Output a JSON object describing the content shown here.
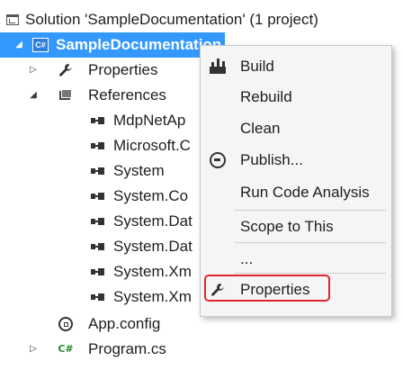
{
  "solution": {
    "label": "Solution 'SampleDocumentation' (1 project)",
    "icon": "solution-icon"
  },
  "project": {
    "label": "SampleDocumentation",
    "icon": "csharp-project-icon",
    "expanded": true,
    "selected": true
  },
  "tree_items": [
    {
      "label": "Properties",
      "icon": "wrench-icon",
      "arrow": "▷"
    },
    {
      "label": "References",
      "icon": "references-icon",
      "arrow": "◢"
    },
    {
      "label": "MdpNetAp",
      "icon": "assembly-icon"
    },
    {
      "label": "Microsoft.C",
      "icon": "assembly-icon"
    },
    {
      "label": "System",
      "icon": "assembly-icon"
    },
    {
      "label": "System.Co",
      "icon": "assembly-icon"
    },
    {
      "label": "System.Dat",
      "icon": "assembly-icon"
    },
    {
      "label": "System.Dat",
      "icon": "assembly-icon"
    },
    {
      "label": "System.Xm",
      "icon": "assembly-icon"
    },
    {
      "label": "System.Xm",
      "icon": "assembly-icon"
    },
    {
      "label": "App.config",
      "icon": "config-icon"
    },
    {
      "label": "Program.cs",
      "icon": "csharp-file-icon",
      "arrow": "▷"
    }
  ],
  "context_menu": {
    "items": [
      {
        "label": "Build",
        "icon": "build-icon"
      },
      {
        "label": "Rebuild"
      },
      {
        "label": "Clean"
      },
      {
        "label": "Publish...",
        "icon": "publish-icon"
      },
      {
        "label": "Run Code Analysis"
      },
      {
        "label": "Scope to This"
      },
      {
        "label": "..."
      },
      {
        "label": "Properties",
        "icon": "wrench-icon",
        "highlighted": true
      }
    ]
  },
  "colors": {
    "selection": "#3399ff",
    "highlight_border": "#e0262b",
    "menu_bg": "#f5f5f5"
  },
  "glyphs": {
    "project_icon_text": "C#",
    "cs_icon_text": "C#",
    "expanded_arrow": "◢",
    "collapsed_arrow": "▷",
    "wrench": "🔧"
  }
}
